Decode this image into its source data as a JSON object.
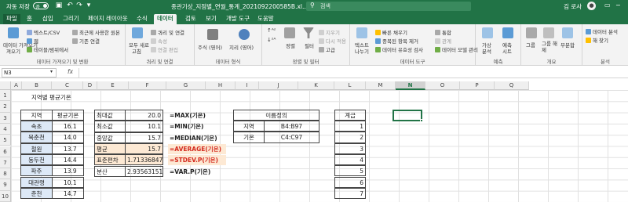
{
  "titlebar": {
    "autosave_label": "자동 저장",
    "autosave_state": "끔",
    "doc_title": "종관기상_지점별_연월_통계_2021092200585B.xl...",
    "search_placeholder": "검색",
    "user_name": "김 로사",
    "brand_color": "#217346"
  },
  "tabs": [
    "파일",
    "홈",
    "삽입",
    "그리기",
    "페이지 레이아웃",
    "수식",
    "데이터",
    "검토",
    "보기",
    "개발 도구",
    "도움말"
  ],
  "active_tab": "데이터",
  "ribbon": {
    "get_data": {
      "big_label": "데이터 가져오기",
      "big_label2": "져오기",
      "items": [
        "텍스트/CSV",
        "웹",
        "테이블/범위에서",
        "최근에 사용한 원본",
        "기존 연결"
      ],
      "group_label": "데이터 가져오기 및 변환"
    },
    "queries": {
      "big_label": "모두 새로",
      "big_label2": "고침",
      "items": [
        "쿼리 및 연결",
        "속성",
        "연결 편집"
      ],
      "group_label": "쿼리 및 연결"
    },
    "data_types": {
      "stock": "주식 (영어)",
      "geo": "지리 (영어)",
      "group_label": "데이터 형식"
    },
    "sort_filter": {
      "sort_label": "정렬",
      "filter_label": "필터",
      "items": [
        "지우기",
        "다시 적용",
        "고급"
      ],
      "group_label": "정렬 및 필터"
    },
    "data_tools": {
      "text_to_col": "텍스트",
      "text_to_col2": "나누기",
      "items": [
        "빠른 채우기",
        "중복된 항목 제거",
        "데이터 유효성 검사",
        "통합",
        "관계",
        "데이터 모델 관리"
      ],
      "group_label": "데이터 도구"
    },
    "forecast": {
      "whatif": "가상",
      "whatif2": "분석",
      "sheet": "예측",
      "sheet2": "시트",
      "group_label": "예측"
    },
    "outline": {
      "items": [
        "그룹",
        "그룹 해제",
        "부분합"
      ],
      "group_label": "개요"
    },
    "analysis": {
      "items": [
        "데이터 분석",
        "해 찾기"
      ],
      "group_label": "분석"
    }
  },
  "formula_bar": {
    "name_box": "N3",
    "fx_label": "fx",
    "formula": ""
  },
  "columns": [
    "A",
    "B",
    "C",
    "D",
    "E",
    "F",
    "G",
    "H",
    "I",
    "J",
    "K",
    "L",
    "M",
    "N",
    "O",
    "P",
    "Q"
  ],
  "rows": [
    "1",
    "2",
    "3",
    "4",
    "5",
    "6",
    "7",
    "8",
    "9",
    "10"
  ],
  "sheet": {
    "title": "지역별 평균기온",
    "region_table": {
      "headers": [
        "지역",
        "평균기온"
      ],
      "rows": [
        [
          "속초",
          "16.1"
        ],
        [
          "북춘천",
          "14.0"
        ],
        [
          "철원",
          "13.7"
        ],
        [
          "동두천",
          "14.4"
        ],
        [
          "파주",
          "13.9"
        ],
        [
          "대관령",
          "10.1"
        ],
        [
          "춘천",
          "14.7"
        ]
      ]
    },
    "stats": [
      {
        "label": "최대값",
        "value": "20.0",
        "formula": "=MAX(기온)",
        "highlight": false
      },
      {
        "label": "최소값",
        "value": "10.1",
        "formula": "=MIN(기온)",
        "highlight": false
      },
      {
        "label": "중앙값",
        "value": "15.7",
        "formula": "=MEDIAN(기온)",
        "highlight": false
      },
      {
        "label": "평균",
        "value": "15.7",
        "formula": "=AVERAGE(기온)",
        "highlight": true
      },
      {
        "label": "표준편차",
        "value": "1.71336847",
        "formula": "=STDEV.P(기온)",
        "highlight": true
      },
      {
        "label": "분산",
        "value": "2.93563151",
        "formula": "=VAR.P(기온)",
        "highlight": false
      }
    ],
    "names_table": {
      "title": "이름정의",
      "rows": [
        [
          "지역",
          "B4:B97"
        ],
        [
          "기온",
          "C4:C97"
        ]
      ]
    },
    "rank_table": {
      "header": "계급",
      "values": [
        "1",
        "2",
        "3",
        "4",
        "5",
        "6",
        "7"
      ]
    }
  }
}
